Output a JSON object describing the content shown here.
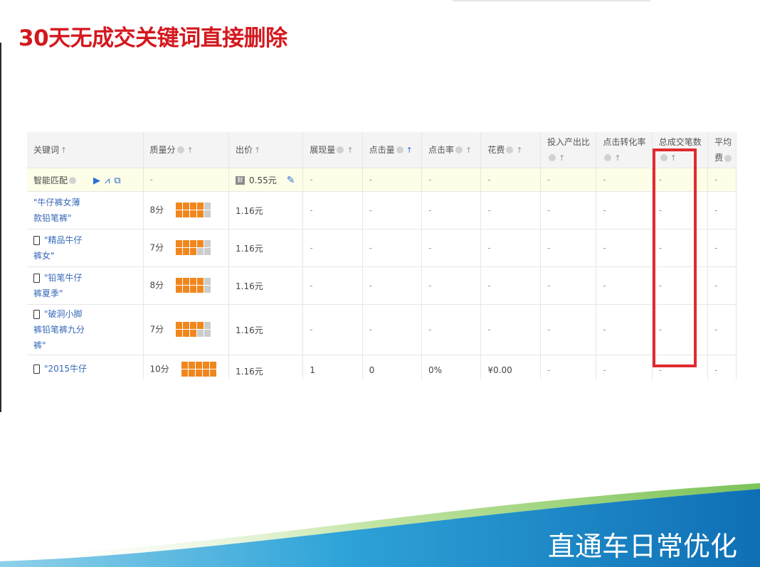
{
  "slide": {
    "title": "30天无成交关键词直接删除",
    "footer": "直通车日常优化"
  },
  "colors": {
    "title": "#d4181e",
    "highlight_box": "#e12a2e",
    "link": "#3568b8",
    "quality_bar_on": "#f0871e",
    "quality_bar_off": "#cccccc",
    "footer_band": "#1a8bc6"
  },
  "table": {
    "headers": {
      "keyword": "关键词",
      "quality": "质量分",
      "bid": "出价",
      "impressions": "展现量",
      "clicks": "点击量",
      "ctr": "点击率",
      "cost": "花费",
      "roi": "投入产出比",
      "cvr": "点击转化率",
      "orders": "总成交笔数",
      "avg": "平均",
      "avg_line2": "费"
    },
    "smart": {
      "label": "智能匹配",
      "quality": "-",
      "bid": "0.55元",
      "price_icon": "默",
      "dash": "-"
    },
    "rows": [
      {
        "keyword_l1": "\"牛仔裤女薄",
        "keyword_l2": "款铅笔裤\"",
        "quality": "8分",
        "level": 0.8,
        "mobile": false,
        "bid": "1.16元",
        "impressions": "-",
        "clicks": "-",
        "ctr": "-",
        "cost": "-",
        "roi": "-",
        "cvr": "-",
        "orders": "-",
        "avg": "-"
      },
      {
        "keyword_l1": "\"精品牛仔",
        "keyword_l2": "裤女\"",
        "quality": "7分",
        "level": 0.7,
        "mobile": true,
        "bid": "1.16元",
        "impressions": "-",
        "clicks": "-",
        "ctr": "-",
        "cost": "-",
        "roi": "-",
        "cvr": "-",
        "orders": "-",
        "avg": "-"
      },
      {
        "keyword_l1": "\"铅笔牛仔",
        "keyword_l2": "裤夏季\"",
        "quality": "8分",
        "level": 0.8,
        "mobile": true,
        "bid": "1.16元",
        "impressions": "-",
        "clicks": "-",
        "ctr": "-",
        "cost": "-",
        "roi": "-",
        "cvr": "-",
        "orders": "-",
        "avg": "-"
      },
      {
        "keyword_l1": "\"破洞小脚",
        "keyword_l2": "裤铅笔裤九分",
        "keyword_l3": "裤\"",
        "quality": "7分",
        "level": 0.7,
        "mobile": true,
        "bid": "1.16元",
        "impressions": "-",
        "clicks": "-",
        "ctr": "-",
        "cost": "-",
        "roi": "-",
        "cvr": "-",
        "orders": "-",
        "avg": "-"
      },
      {
        "keyword_l1": "\"2015牛仔",
        "quality": "10分",
        "level": 1.0,
        "mobile": true,
        "bid": "1.16元",
        "impressions": "1",
        "clicks": "0",
        "ctr": "0%",
        "cost": "¥0.00",
        "roi": "-",
        "cvr": "-",
        "orders": "-",
        "avg": "-"
      }
    ]
  }
}
